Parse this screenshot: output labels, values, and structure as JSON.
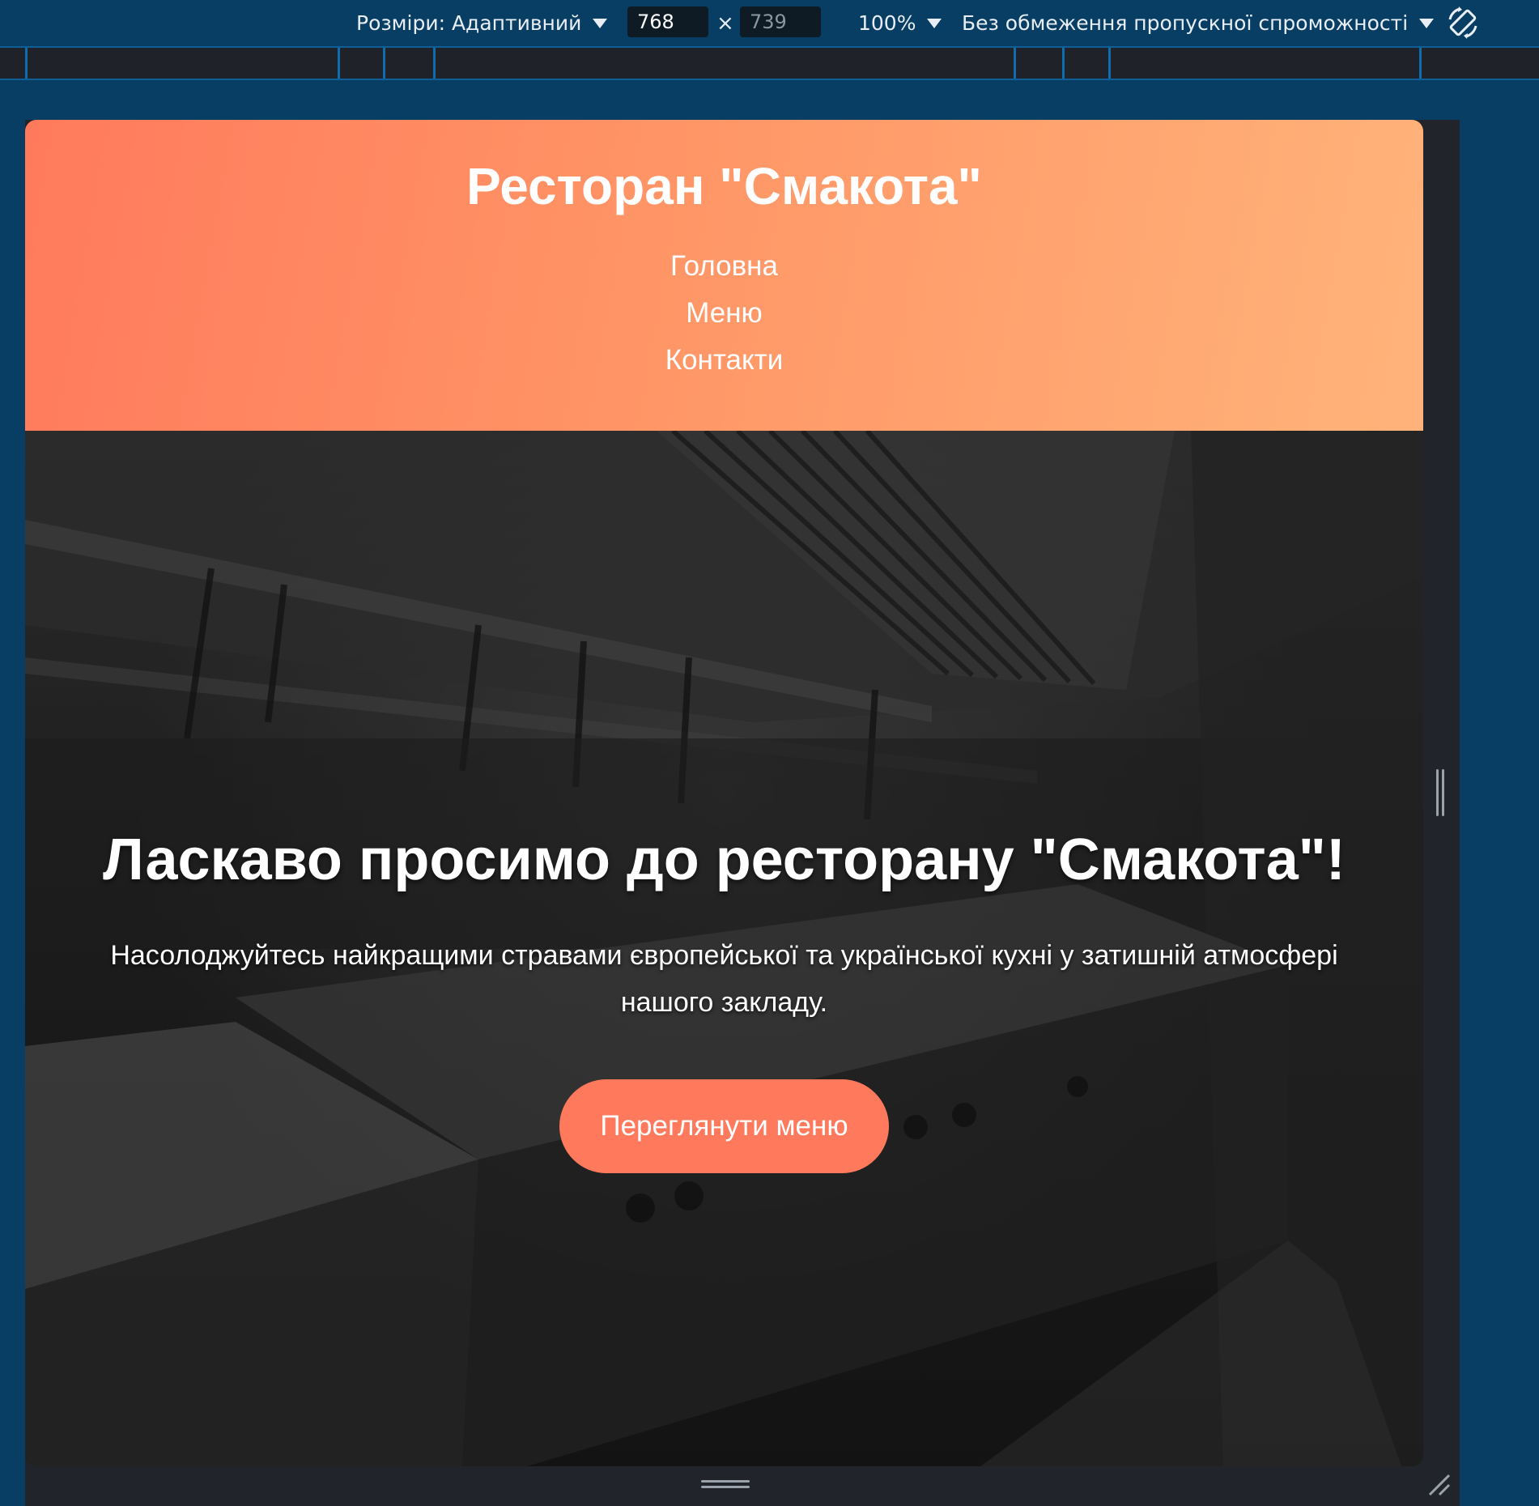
{
  "devtools": {
    "dimensions_label": "Розміри: Адаптивний",
    "width_value": "768",
    "height_placeholder": "739",
    "times_symbol": "×",
    "zoom_label": "100%",
    "throttling_label": "Без обмеження пропускної спроможності",
    "rotate_icon": "rotate-icon"
  },
  "site": {
    "title": "Ресторан \"Смакота\"",
    "nav": [
      {
        "label": "Головна"
      },
      {
        "label": "Меню"
      },
      {
        "label": "Контакти"
      }
    ],
    "hero": {
      "title": "Ласкаво просимо до ресторану \"Смакота\"!",
      "text": "Насолоджуйтесь найкращими стравами європейської та української кухні у затишній атмосфері нашого закладу.",
      "button_label": "Переглянути меню"
    },
    "colors": {
      "header_gradient_start": "#ff7a5c",
      "header_gradient_end": "#ffb37a",
      "button": "#ff7a5c",
      "devtools_bg": "#083e64"
    }
  }
}
